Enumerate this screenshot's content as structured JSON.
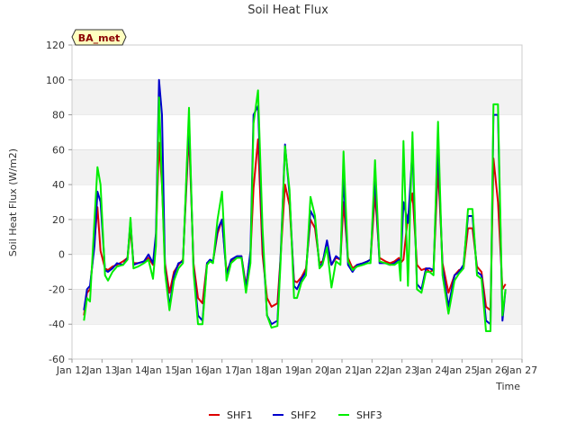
{
  "chart_data": {
    "type": "line",
    "title": "Soil Heat Flux",
    "xlabel": "Time",
    "ylabel": "Soil Heat Flux (W/m2)",
    "badge": "BA_met",
    "ylim": [
      -60,
      120
    ],
    "yticks": [
      -60,
      -40,
      -20,
      0,
      20,
      40,
      60,
      80,
      100,
      120
    ],
    "xlim": [
      12,
      27
    ],
    "xticks": [
      12,
      13,
      14,
      15,
      16,
      17,
      18,
      19,
      20,
      21,
      22,
      23,
      24,
      25,
      26,
      27
    ],
    "xtick_labels": [
      "Jan 12",
      "Jan 13",
      "Jan 14",
      "Jan 15",
      "Jan 16",
      "Jan 17",
      "Jan 18",
      "Jan 19",
      "Jan 20",
      "Jan 21",
      "Jan 22",
      "Jan 23",
      "Jan 24",
      "Jan 25",
      "Jan 26",
      "Jan 27"
    ],
    "legend_position": "bottom-center",
    "grid": "horizontal-bands",
    "series": [
      {
        "name": "SHF1",
        "color": "#dd0000",
        "x": [
          12.4,
          12.5,
          12.6,
          12.75,
          12.85,
          12.95,
          13.1,
          13.2,
          13.35,
          13.5,
          13.7,
          13.85,
          13.95,
          14.05,
          14.2,
          14.4,
          14.55,
          14.7,
          14.8,
          14.9,
          15.0,
          15.1,
          15.25,
          15.4,
          15.55,
          15.7,
          15.9,
          16.05,
          16.2,
          16.35,
          16.5,
          16.6,
          16.7,
          16.85,
          17.0,
          17.15,
          17.3,
          17.5,
          17.65,
          17.8,
          17.95,
          18.05,
          18.2,
          18.35,
          18.5,
          18.65,
          18.85,
          18.95,
          19.1,
          19.25,
          19.4,
          19.5,
          19.65,
          19.8,
          19.95,
          20.1,
          20.25,
          20.35,
          20.5,
          20.65,
          20.8,
          20.95,
          21.05,
          21.2,
          21.35,
          21.5,
          21.7,
          21.85,
          21.95,
          22.1,
          22.25,
          22.45,
          22.6,
          22.75,
          22.9,
          22.95,
          23.05,
          23.2,
          23.35,
          23.5,
          23.65,
          23.8,
          23.92,
          24.05,
          24.2,
          24.35,
          24.55,
          24.75,
          24.9,
          25.05,
          25.2,
          25.35,
          25.5,
          25.65,
          25.8,
          25.95,
          26.05,
          26.2,
          26.35,
          26.45
        ],
        "values": [
          -35,
          -22,
          -20,
          8,
          27,
          2,
          -8,
          -9,
          -7,
          -6,
          -4,
          -2,
          15,
          -5,
          -5,
          -4,
          -2,
          -6,
          10,
          64,
          40,
          -5,
          -22,
          -10,
          -6,
          -3,
          70,
          -5,
          -25,
          -28,
          -5,
          -4,
          -4,
          12,
          20,
          -10,
          -4,
          -2,
          -1,
          -18,
          0,
          38,
          66,
          0,
          -25,
          -30,
          -28,
          -2,
          40,
          28,
          -15,
          -16,
          -13,
          -8,
          20,
          15,
          -5,
          -4,
          4,
          -6,
          -2,
          -3,
          30,
          -2,
          -8,
          -6,
          -5,
          -4,
          -3,
          35,
          -2,
          -4,
          -5,
          -4,
          -2,
          -5,
          -3,
          22,
          35,
          -6,
          -9,
          -8,
          -10,
          -9,
          50,
          -5,
          -22,
          -12,
          -9,
          -8,
          15,
          15,
          -7,
          -10,
          -30,
          -32,
          55,
          30,
          -20,
          -17
        ]
      },
      {
        "name": "SHF2",
        "color": "#0000cc",
        "x": [
          12.4,
          12.5,
          12.6,
          12.75,
          12.85,
          12.95,
          13.1,
          13.2,
          13.35,
          13.5,
          13.7,
          13.85,
          13.95,
          14.05,
          14.2,
          14.4,
          14.55,
          14.7,
          14.8,
          14.9,
          15.0,
          15.1,
          15.25,
          15.4,
          15.55,
          15.7,
          15.9,
          16.05,
          16.2,
          16.35,
          16.5,
          16.6,
          16.7,
          16.85,
          17.0,
          17.15,
          17.3,
          17.5,
          17.65,
          17.8,
          17.95,
          18.05,
          18.2,
          18.35,
          18.5,
          18.65,
          18.85,
          18.95,
          19.1,
          19.25,
          19.4,
          19.5,
          19.65,
          19.8,
          19.95,
          20.1,
          20.25,
          20.35,
          20.5,
          20.65,
          20.8,
          20.95,
          21.05,
          21.2,
          21.35,
          21.5,
          21.7,
          21.85,
          21.95,
          22.1,
          22.25,
          22.45,
          22.6,
          22.75,
          22.9,
          22.95,
          23.05,
          23.2,
          23.35,
          23.5,
          23.65,
          23.8,
          23.92,
          24.05,
          24.2,
          24.35,
          24.55,
          24.75,
          24.9,
          25.05,
          25.2,
          25.35,
          25.5,
          25.65,
          25.8,
          25.95,
          26.05,
          26.2,
          26.35,
          26.45
        ],
        "values": [
          -32,
          -20,
          -18,
          5,
          36,
          30,
          -9,
          -10,
          -8,
          -5,
          -6,
          -2,
          19,
          -6,
          -5,
          -4,
          0,
          -5,
          12,
          100,
          80,
          -8,
          -30,
          -12,
          -5,
          -4,
          78,
          -8,
          -35,
          -38,
          -5,
          -3,
          -4,
          14,
          20,
          -12,
          -3,
          -1,
          -1,
          -20,
          2,
          80,
          85,
          10,
          -35,
          -40,
          -38,
          -2,
          63,
          34,
          -18,
          -20,
          -14,
          -10,
          25,
          20,
          -7,
          -5,
          8,
          -6,
          -1,
          -3,
          45,
          -6,
          -10,
          -6,
          -5,
          -4,
          -3,
          45,
          -5,
          -5,
          -6,
          -5,
          -3,
          -10,
          30,
          18,
          60,
          -17,
          -20,
          -8,
          -8,
          -9,
          63,
          -8,
          -30,
          -12,
          -10,
          -6,
          22,
          22,
          -10,
          -12,
          -38,
          -40,
          80,
          80,
          -38,
          -20
        ]
      },
      {
        "name": "SHF3",
        "color": "#00ee00",
        "x": [
          12.4,
          12.5,
          12.6,
          12.75,
          12.85,
          12.95,
          13.1,
          13.2,
          13.35,
          13.5,
          13.7,
          13.85,
          13.95,
          14.05,
          14.2,
          14.4,
          14.55,
          14.7,
          14.8,
          14.9,
          15.0,
          15.1,
          15.25,
          15.4,
          15.55,
          15.7,
          15.9,
          16.05,
          16.2,
          16.35,
          16.5,
          16.6,
          16.7,
          16.85,
          17.0,
          17.15,
          17.3,
          17.5,
          17.65,
          17.8,
          17.95,
          18.05,
          18.2,
          18.35,
          18.5,
          18.65,
          18.85,
          18.95,
          19.1,
          19.25,
          19.4,
          19.5,
          19.65,
          19.8,
          19.95,
          20.1,
          20.25,
          20.35,
          20.5,
          20.65,
          20.8,
          20.95,
          21.05,
          21.2,
          21.35,
          21.5,
          21.7,
          21.85,
          21.95,
          22.1,
          22.25,
          22.45,
          22.6,
          22.75,
          22.9,
          22.95,
          23.05,
          23.2,
          23.35,
          23.5,
          23.65,
          23.8,
          23.92,
          24.05,
          24.2,
          24.35,
          24.55,
          24.75,
          24.9,
          25.05,
          25.2,
          25.35,
          25.5,
          25.65,
          25.8,
          25.95,
          26.05,
          26.2,
          26.35,
          26.45
        ],
        "values": [
          -38,
          -25,
          -27,
          20,
          50,
          40,
          -12,
          -15,
          -10,
          -7,
          -6,
          -3,
          21,
          -8,
          -7,
          -5,
          -3,
          -14,
          5,
          90,
          40,
          -10,
          -32,
          -15,
          -8,
          -5,
          84,
          -10,
          -40,
          -40,
          -6,
          -4,
          -5,
          20,
          36,
          -15,
          -5,
          -2,
          -2,
          -22,
          -5,
          75,
          94,
          15,
          -35,
          -42,
          -41,
          -5,
          62,
          37,
          -25,
          -25,
          -16,
          -12,
          33,
          22,
          -8,
          -6,
          4,
          -19,
          -4,
          -6,
          59,
          -4,
          -9,
          -7,
          -6,
          -5,
          -5,
          54,
          -4,
          -5,
          -6,
          -6,
          -4,
          -15,
          65,
          -18,
          70,
          -20,
          -22,
          -10,
          -10,
          -12,
          76,
          -12,
          -34,
          -15,
          -11,
          -8,
          26,
          26,
          -12,
          -14,
          -44,
          -44,
          86,
          86,
          -35,
          -20
        ]
      }
    ]
  }
}
